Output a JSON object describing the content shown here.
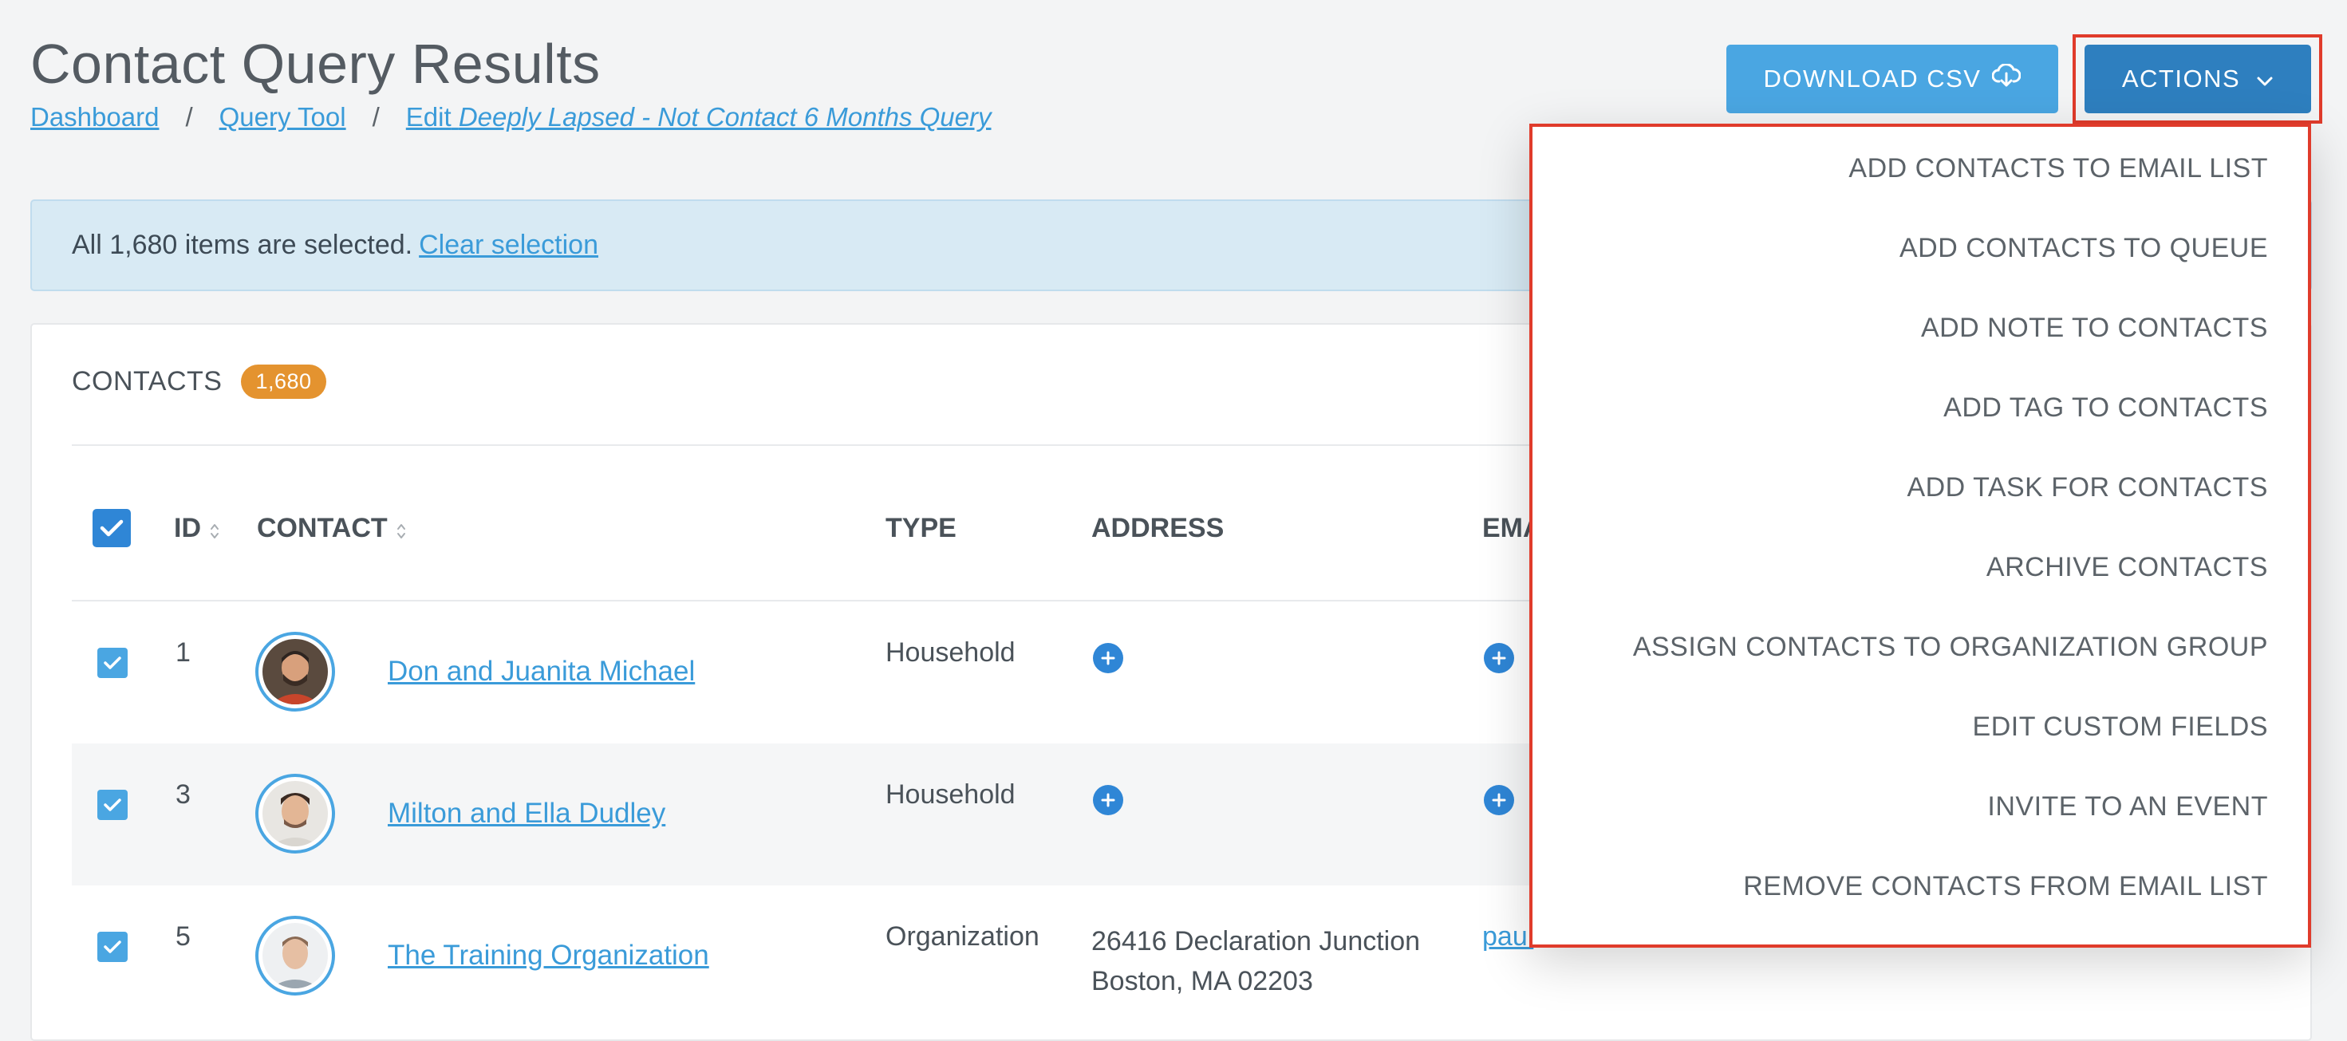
{
  "header": {
    "title": "Contact Query Results",
    "breadcrumb": {
      "dashboard": "Dashboard",
      "separator": "/",
      "query_tool": "Query Tool",
      "edit_prefix": "Edit",
      "edit_query_name": "Deeply Lapsed - Not Contact 6 Months Query"
    },
    "download_csv_label": "DOWNLOAD CSV",
    "actions_label": "ACTIONS"
  },
  "selection_alert": {
    "message": "All 1,680 items are selected.",
    "clear_label": "Clear selection"
  },
  "contacts_panel": {
    "title": "CONTACTS",
    "count": "1,680",
    "columns": {
      "id": "ID",
      "contact": "CONTACT",
      "type": "TYPE",
      "address": "ADDRESS",
      "email": "EMA"
    },
    "rows": [
      {
        "id": "1",
        "name": "Don and Juanita Michael",
        "type": "Household",
        "address_line1": "",
        "address_line2": "",
        "email": ""
      },
      {
        "id": "3",
        "name": "Milton and Ella Dudley",
        "type": "Household",
        "address_line1": "",
        "address_line2": "",
        "email": ""
      },
      {
        "id": "5",
        "name": "The Training Organization",
        "type": "Organization",
        "address_line1": "26416 Declaration Junction",
        "address_line2": "Boston, MA 02203",
        "email": "paul"
      }
    ]
  },
  "actions_menu": {
    "items": [
      "ADD CONTACTS TO EMAIL LIST",
      "ADD CONTACTS TO QUEUE",
      "ADD NOTE TO CONTACTS",
      "ADD TAG TO CONTACTS",
      "ADD TASK FOR CONTACTS",
      "ARCHIVE CONTACTS",
      "ASSIGN CONTACTS TO ORGANIZATION GROUP",
      "EDIT CUSTOM FIELDS",
      "INVITE TO AN EVENT",
      "REMOVE CONTACTS FROM EMAIL LIST"
    ]
  },
  "colors": {
    "primary": "#4aa6e2",
    "primary_dark": "#2e7fbf",
    "highlight_outline": "#e03b2b",
    "badge": "#e4932f",
    "alert_bg": "#d8eaf4"
  },
  "icons": {
    "download": "cloud-download-icon",
    "chevron": "chevron-down-icon",
    "sort": "sort-icon",
    "add": "plus-circle-icon",
    "check": "checkmark-icon"
  }
}
